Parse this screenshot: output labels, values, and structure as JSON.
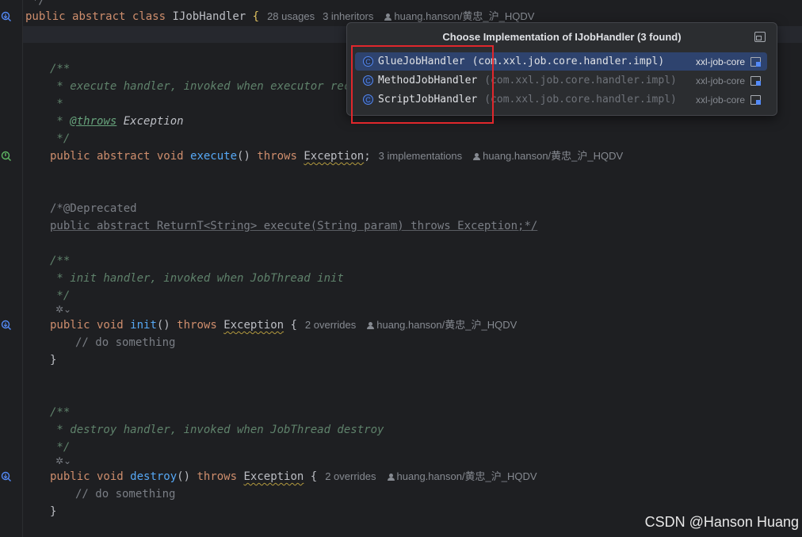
{
  "editor": {
    "class_decl": {
      "kw_public": "public",
      "kw_abstract": "abstract",
      "kw_class": "class",
      "name": "IJobHandler",
      "brace": "{",
      "usages": "28 usages",
      "inheritors": "3 inheritors",
      "author": "huang.hanson/黄忠_沪_HQDV"
    },
    "lines": {
      "doc1_open": "/**",
      "doc1_text": " * execute handler, invoked when executor recei",
      "doc1_blank": " *",
      "doc1_throws_prefix": " * ",
      "doc1_throws_tag": "@throws",
      "doc1_throws_rest": " Exception",
      "doc1_close": " */",
      "execute_sig": {
        "mods": "public abstract void",
        "name": "execute",
        "params": "()",
        "throws": "throws",
        "exc": "Exception",
        "end": ";",
        "impls": "3 implementations",
        "author": "huang.hanson/黄忠_沪_HQDV"
      },
      "deprecated_1": "/*@Deprecated",
      "deprecated_2": "public abstract ReturnT<String> execute(String param) throws Exception;*/",
      "doc2_open": "/**",
      "doc2_text": " * init handler, invoked when JobThread init",
      "doc2_close": " */",
      "init_sig": {
        "mods": "public void",
        "name": "init",
        "params": "()",
        "throws": "throws",
        "exc": "Exception",
        "brace": "{",
        "overrides": "2 overrides",
        "author": "huang.hanson/黄忠_沪_HQDV"
      },
      "init_body": "// do something",
      "init_close": "}",
      "doc3_open": "/**",
      "doc3_text": " * destroy handler, invoked when JobThread destroy",
      "doc3_close": " */",
      "destroy_sig": {
        "mods": "public void",
        "name": "destroy",
        "params": "()",
        "throws": "throws",
        "exc": "Exception",
        "brace": "{",
        "overrides": "2 overrides",
        "author": "huang.hanson/黄忠_沪_HQDV"
      },
      "destroy_body": "// do something",
      "destroy_close": "}",
      "top_fragment": " */"
    }
  },
  "popup": {
    "title": "Choose Implementation of IJobHandler (3 found)",
    "items": [
      {
        "name": "GlueJobHandler",
        "package": "(com.xxl.job.core.handler.impl)",
        "module": "xxl-job-core",
        "selected": true
      },
      {
        "name": "MethodJobHandler",
        "package": "(com.xxl.job.core.handler.impl)",
        "module": "xxl-job-core",
        "selected": false
      },
      {
        "name": "ScriptJobHandler",
        "package": "(com.xxl.job.core.handler.impl)",
        "module": "xxl-job-core",
        "selected": false
      }
    ],
    "class_icon_letter": "C"
  },
  "watermark": "CSDN @Hanson Huang",
  "colors": {
    "background": "#1e1f22",
    "keyword": "#cf8e6d",
    "method": "#56a8f5",
    "doc_comment": "#5f826b",
    "selection": "#2e436e",
    "annotation_box": "#e0272c"
  }
}
